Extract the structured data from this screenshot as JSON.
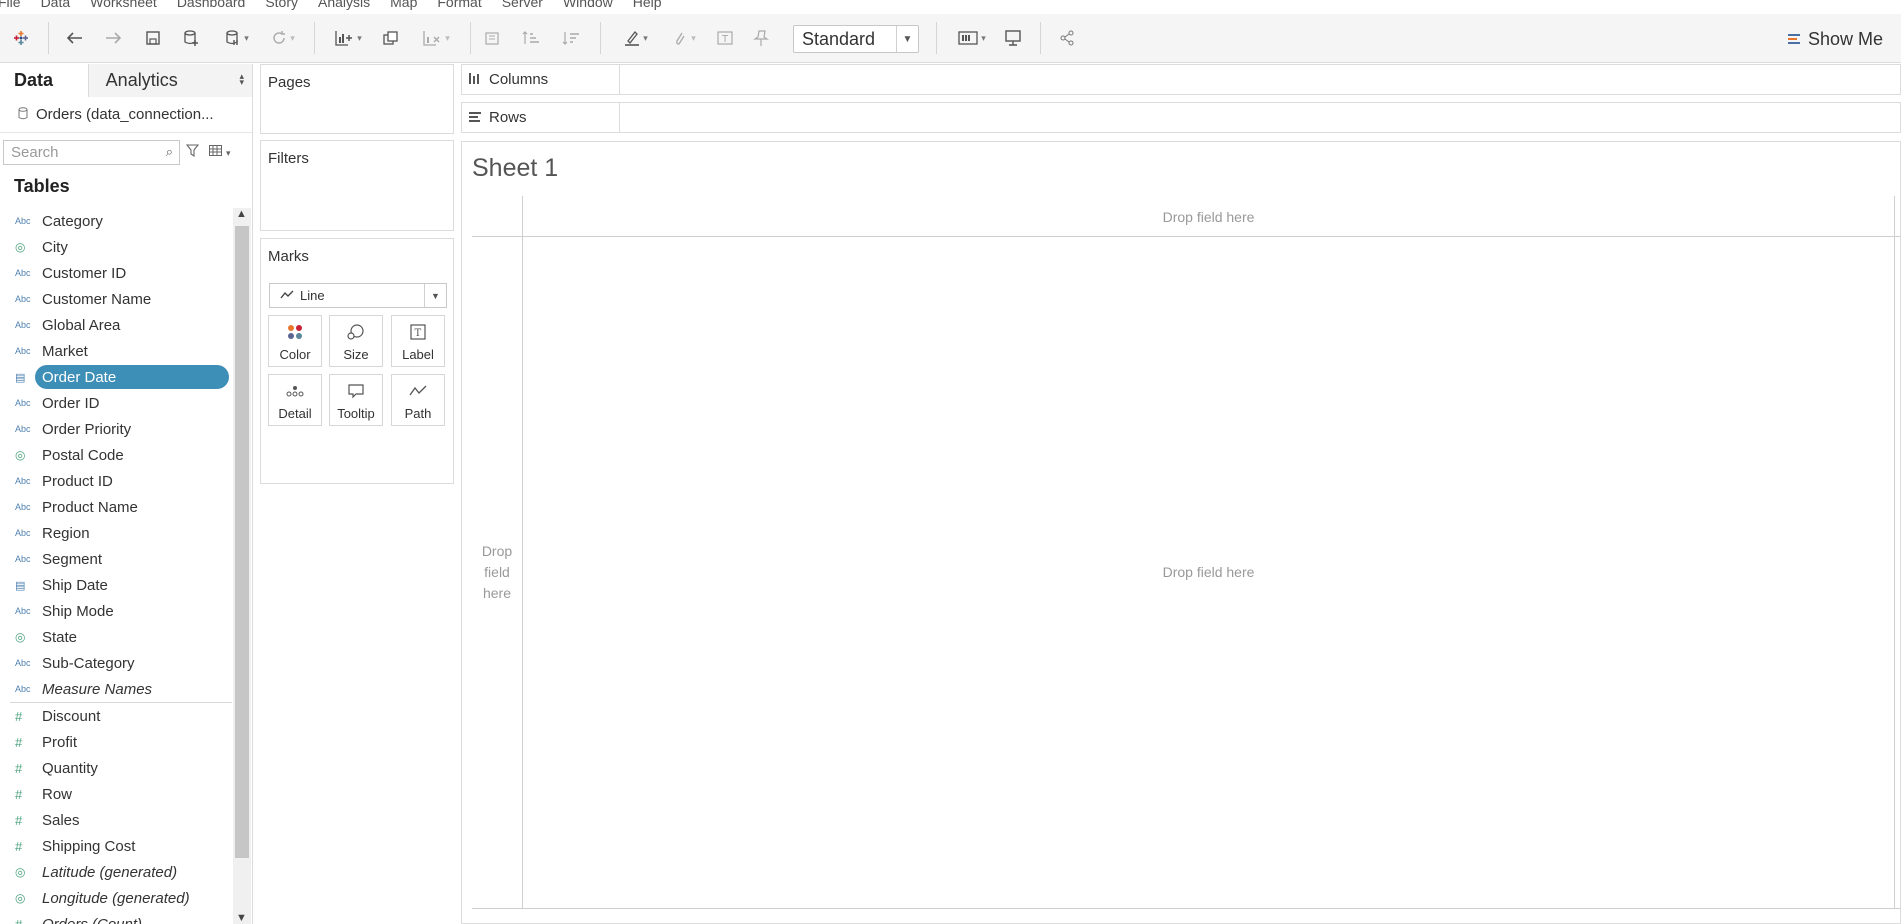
{
  "menu": [
    "File",
    "Data",
    "Worksheet",
    "Dashboard",
    "Story",
    "Analysis",
    "Map",
    "Format",
    "Server",
    "Window",
    "Help"
  ],
  "toolbar": {
    "view_select": "Standard",
    "show_me": "Show Me"
  },
  "left_pane": {
    "tabs": {
      "data": "Data",
      "analytics": "Analytics"
    },
    "connection": "Orders (data_connection...",
    "search_placeholder": "Search",
    "tables_heading": "Tables",
    "fields": [
      {
        "name": "Category",
        "type": "Abc"
      },
      {
        "name": "City",
        "type": "geo"
      },
      {
        "name": "Customer ID",
        "type": "Abc"
      },
      {
        "name": "Customer Name",
        "type": "Abc"
      },
      {
        "name": "Global Area",
        "type": "Abc"
      },
      {
        "name": "Market",
        "type": "Abc"
      },
      {
        "name": "Order Date",
        "type": "date",
        "selected": true
      },
      {
        "name": "Order ID",
        "type": "Abc"
      },
      {
        "name": "Order Priority",
        "type": "Abc"
      },
      {
        "name": "Postal Code",
        "type": "geo"
      },
      {
        "name": "Product ID",
        "type": "Abc"
      },
      {
        "name": "Product Name",
        "type": "Abc"
      },
      {
        "name": "Region",
        "type": "Abc"
      },
      {
        "name": "Segment",
        "type": "Abc"
      },
      {
        "name": "Ship Date",
        "type": "date"
      },
      {
        "name": "Ship Mode",
        "type": "Abc"
      },
      {
        "name": "State",
        "type": "geo"
      },
      {
        "name": "Sub-Category",
        "type": "Abc"
      },
      {
        "name": "Measure Names",
        "type": "Abc",
        "italic": true
      }
    ],
    "measures": [
      {
        "name": "Discount",
        "type": "num"
      },
      {
        "name": "Profit",
        "type": "num"
      },
      {
        "name": "Quantity",
        "type": "num"
      },
      {
        "name": "Row",
        "type": "num"
      },
      {
        "name": "Sales",
        "type": "num"
      },
      {
        "name": "Shipping Cost",
        "type": "num"
      },
      {
        "name": "Latitude (generated)",
        "type": "geo",
        "italic": true
      },
      {
        "name": "Longitude (generated)",
        "type": "geo",
        "italic": true
      },
      {
        "name": "Orders (Count)",
        "type": "num",
        "italic": true
      }
    ],
    "type_abc_glyph": "Abc"
  },
  "cards": {
    "pages": "Pages",
    "filters": "Filters",
    "marks": "Marks",
    "mark_type": "Line",
    "mark_buttons": [
      "Color",
      "Size",
      "Label",
      "Detail",
      "Tooltip",
      "Path"
    ]
  },
  "shelves": {
    "columns": "Columns",
    "rows": "Rows"
  },
  "sheet": {
    "title": "Sheet 1",
    "drop_top": "Drop field here",
    "drop_center": "Drop field here",
    "drop_left": "Drop\nfield\nhere"
  },
  "colors": {
    "selected_pill": "#3d8fb7",
    "dimension_icon": "#4f81b0",
    "measure_icon": "#4aa17d"
  }
}
